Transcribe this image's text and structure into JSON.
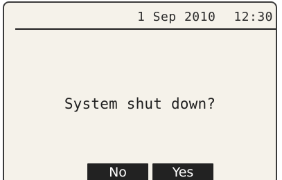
{
  "status_bar": {
    "date": "1 Sep 2010",
    "time": "12:30"
  },
  "dialog": {
    "prompt": "System shut down?"
  },
  "softkeys": {
    "no_label": "No",
    "yes_label": "Yes"
  }
}
